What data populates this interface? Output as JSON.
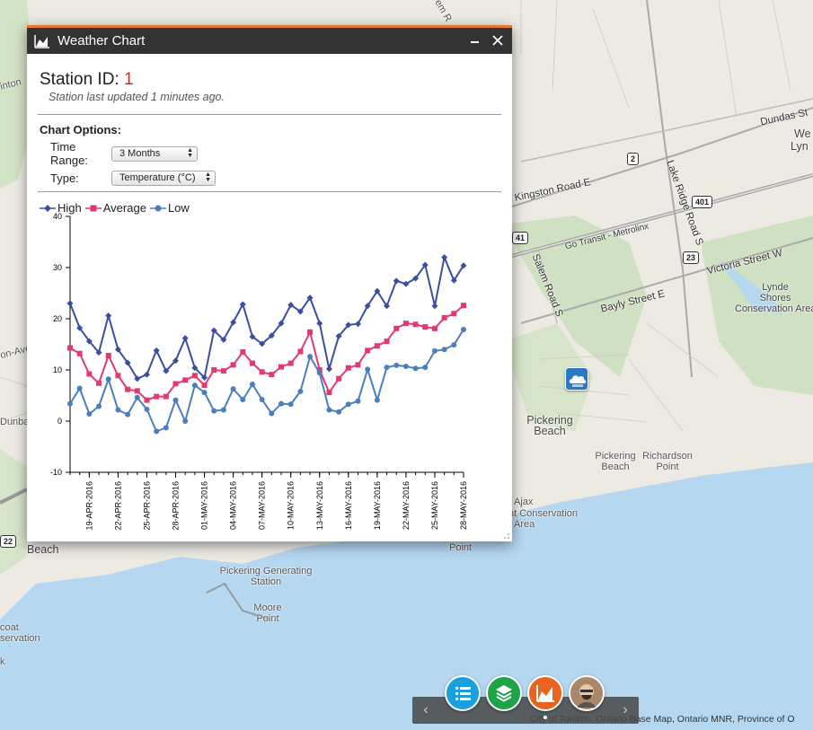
{
  "window": {
    "title": "Weather Chart",
    "minimize_icon": "minimize-icon",
    "close_icon": "close-icon"
  },
  "station": {
    "label": "Station ID:",
    "id": "1",
    "updated": "Station last updated 1 minutes ago."
  },
  "options": {
    "title": "Chart Options:",
    "time_range_label": "Time Range:",
    "time_range_value": "3 Months",
    "type_label": "Type:",
    "type_value": "Temperature (°C)"
  },
  "legend": [
    "High",
    "Average",
    "Low"
  ],
  "colors": {
    "high": "#3b4fa0",
    "average": "#e23a6e",
    "low": "#4a7fbd",
    "accent": "#e8772e"
  },
  "chart_data": {
    "type": "line",
    "ylim": [
      -10,
      40
    ],
    "yticks": [
      -10,
      0,
      10,
      20,
      30,
      40
    ],
    "xtick_labels": [
      "19-APR-2016",
      "22-APR-2016",
      "25-APR-2016",
      "28-APR-2016",
      "01-MAY-2016",
      "04-MAY-2016",
      "07-MAY-2016",
      "10-MAY-2016",
      "13-MAY-2016",
      "16-MAY-2016",
      "19-MAY-2016",
      "22-MAY-2016",
      "25-MAY-2016",
      "28-MAY-2016"
    ],
    "x": [
      "17-APR",
      "18-APR",
      "19-APR",
      "20-APR",
      "21-APR",
      "22-APR",
      "23-APR",
      "24-APR",
      "25-APR",
      "26-APR",
      "27-APR",
      "28-APR",
      "29-APR",
      "30-APR",
      "01-MAY",
      "02-MAY",
      "03-MAY",
      "04-MAY",
      "05-MAY",
      "06-MAY",
      "07-MAY",
      "08-MAY",
      "09-MAY",
      "10-MAY",
      "11-MAY",
      "12-MAY",
      "13-MAY",
      "14-MAY",
      "15-MAY",
      "16-MAY",
      "17-MAY",
      "18-MAY",
      "19-MAY",
      "20-MAY",
      "21-MAY",
      "22-MAY",
      "23-MAY",
      "24-MAY",
      "25-MAY",
      "26-MAY",
      "27-MAY",
      "28-MAY"
    ],
    "series": [
      {
        "name": "High",
        "values": [
          23.0,
          18.2,
          15.6,
          13.4,
          20.6,
          14.0,
          11.4,
          8.3,
          9.1,
          13.8,
          9.8,
          11.8,
          16.2,
          10.4,
          8.5,
          17.7,
          15.9,
          19.3,
          22.8,
          16.5,
          15.1,
          16.7,
          19.1,
          22.7,
          21.4,
          24.1,
          19.1,
          10.2,
          16.6,
          18.8,
          19.0,
          22.5,
          25.4,
          22.5,
          27.4,
          26.8,
          27.9,
          30.5,
          22.5,
          32.0,
          27.5,
          30.4
        ]
      },
      {
        "name": "Average",
        "values": [
          14.3,
          13.2,
          9.2,
          7.4,
          12.8,
          8.9,
          6.2,
          5.9,
          4.1,
          4.8,
          4.8,
          7.3,
          8.0,
          8.9,
          7.0,
          10.0,
          9.8,
          11.0,
          13.5,
          11.3,
          9.6,
          9.1,
          10.6,
          11.3,
          13.6,
          17.4,
          10.0,
          5.6,
          8.3,
          10.4,
          11.0,
          13.8,
          14.7,
          15.6,
          18.1,
          19.1,
          18.9,
          18.4,
          18.1,
          20.2,
          21.0,
          22.6
        ]
      },
      {
        "name": "Low",
        "values": [
          3.4,
          6.4,
          1.4,
          2.9,
          8.2,
          2.2,
          1.3,
          4.6,
          2.3,
          -2.0,
          -1.3,
          4.1,
          0.0,
          7.0,
          5.6,
          2.0,
          2.2,
          6.3,
          4.2,
          7.2,
          4.2,
          1.5,
          3.4,
          3.3,
          5.8,
          12.6,
          9.4,
          2.2,
          1.8,
          3.3,
          3.9,
          10.1,
          4.1,
          10.5,
          10.9,
          10.7,
          10.3,
          10.5,
          13.7,
          14.0,
          14.9,
          17.9
        ]
      }
    ]
  },
  "map": {
    "labels": [
      "Dundas St",
      "Kingston Road E",
      "Go Transit - Metrolinx",
      "Lake Ridge Road S",
      "Victoria Street W",
      "Bayly Street E",
      "Salem Road S",
      "Lynde Shores Conservation Area",
      "Pickering Beach",
      "Pickering Beach",
      "Richardson Point",
      "Ajax",
      "nt Conservation",
      "Area",
      "Point",
      "Pickering Generating Station",
      "Moore Point",
      "Beach",
      "Dunbar",
      "coat",
      "servation",
      "k",
      "on-Ave",
      "inton",
      "We",
      "Lyn",
      "em R"
    ],
    "shields": [
      "2",
      "401",
      "23",
      "41",
      "22"
    ],
    "attribution": "City of Toronto, Ontario Base Map, Ontario MNR, Province of O"
  },
  "toolbar": {
    "prev_icon": "chevron-left-icon",
    "next_icon": "chevron-right-icon",
    "buttons": [
      "list-icon",
      "layers-icon",
      "chart-icon",
      "avatar"
    ]
  }
}
